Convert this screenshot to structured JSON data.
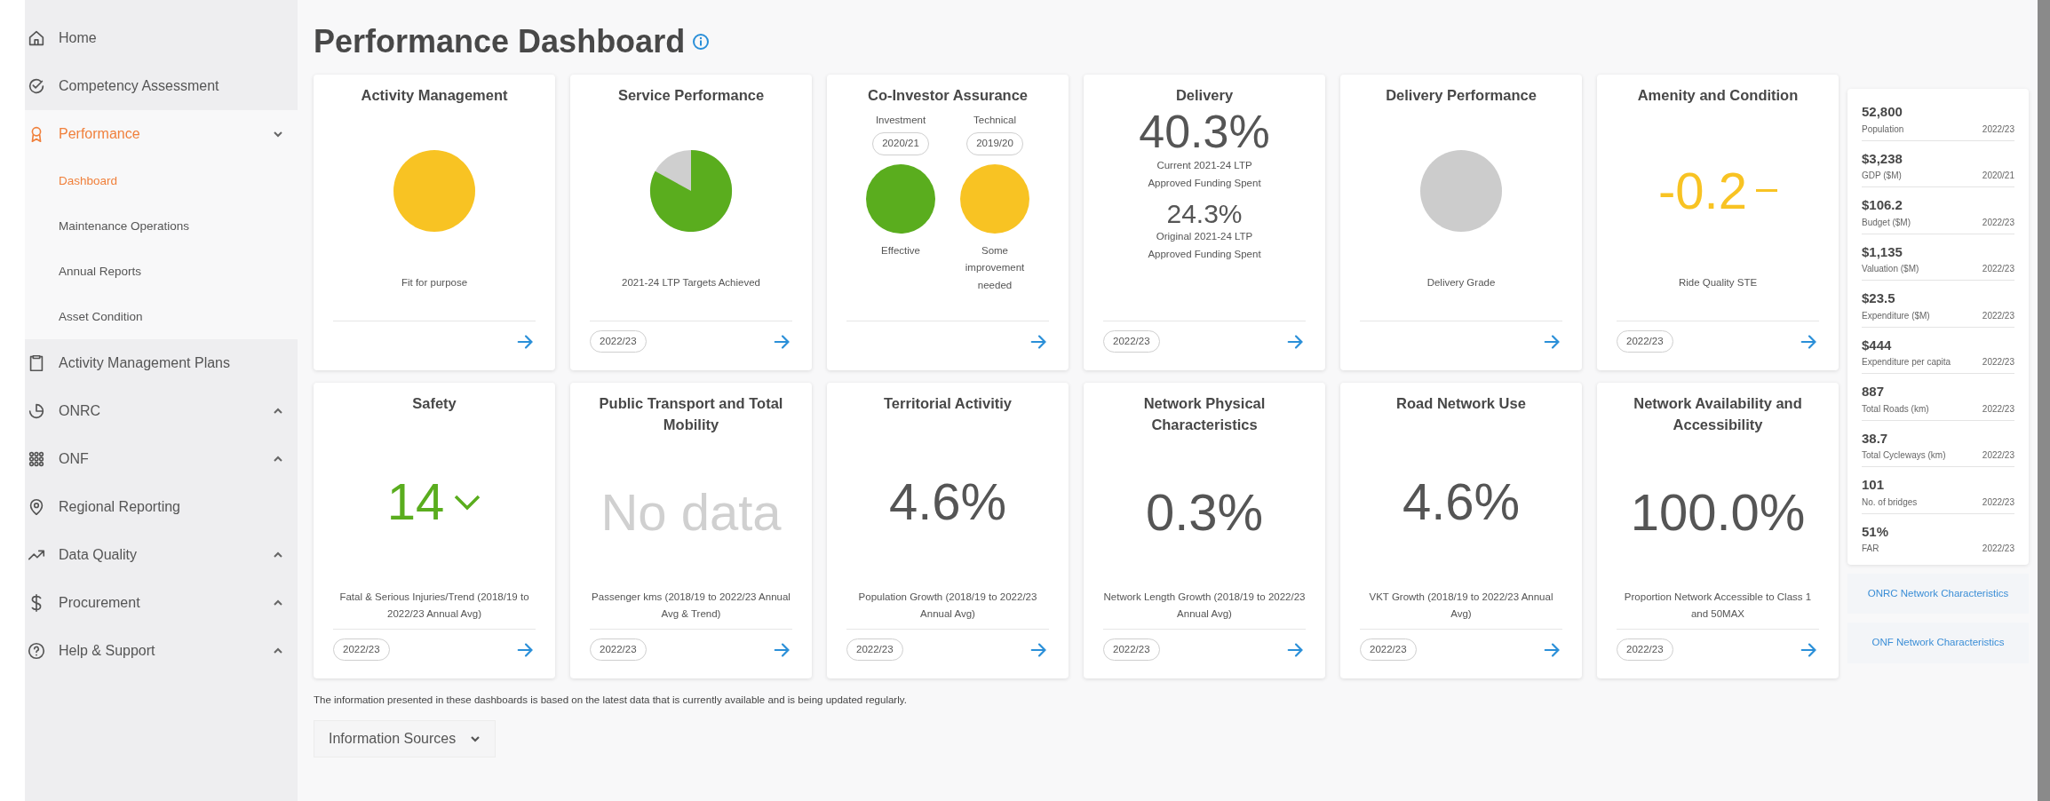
{
  "sidebar": {
    "items": [
      {
        "label": "Home",
        "selected": false
      },
      {
        "label": "Competency Assessment",
        "selected": false
      },
      {
        "label": "Performance",
        "selected": true,
        "expanded": true,
        "children": [
          {
            "label": "Dashboard",
            "selected": true
          },
          {
            "label": "Maintenance Operations",
            "selected": false
          },
          {
            "label": "Annual Reports",
            "selected": false
          },
          {
            "label": "Asset Condition",
            "selected": false
          }
        ]
      },
      {
        "label": "Activity Management Plans",
        "selected": false
      },
      {
        "label": "ONRC",
        "selected": false,
        "expanded": false
      },
      {
        "label": "ONF",
        "selected": false,
        "expanded": false
      },
      {
        "label": "Regional Reporting",
        "selected": false
      },
      {
        "label": "Data Quality",
        "selected": false,
        "expanded": false
      },
      {
        "label": "Procurement",
        "selected": false,
        "expanded": false
      },
      {
        "label": "Help & Support",
        "selected": false,
        "expanded": false
      }
    ]
  },
  "page": {
    "title": "Performance Dashboard"
  },
  "cards": [
    {
      "title": "Activity Management",
      "kind": "dot",
      "color": "#f8c323",
      "caption": "Fit for purpose"
    },
    {
      "title": "Service Performance",
      "kind": "pie",
      "caption": "2021-24 LTP Targets Achieved",
      "badge": "2022/23"
    },
    {
      "title": "Co-Investor Assurance",
      "kind": "dual",
      "items": [
        {
          "label": "Investment",
          "badge": "2020/21",
          "color": "#5aad1e",
          "caption": "Effective"
        },
        {
          "label": "Technical",
          "badge": "2019/20",
          "color": "#f8c323",
          "caption": "Some improvement needed"
        }
      ]
    },
    {
      "title": "Delivery",
      "kind": "figures",
      "figures": [
        {
          "value": "40.3%",
          "caption": "Current 2021-24 LTP Approved Funding Spent",
          "major": true
        },
        {
          "value": "24.3%",
          "caption": "Original 2021-24 LTP Approved Funding Spent",
          "major": false
        }
      ],
      "badge": "2022/23"
    },
    {
      "title": "Delivery Performance",
      "kind": "dot",
      "color": "#cccccc",
      "caption": "Delivery Grade"
    },
    {
      "title": "Amenity and Condition",
      "kind": "value",
      "value": "-0.2",
      "color": "#f8c323",
      "trend_down": false,
      "trend_flat": true,
      "caption": "Ride Quality STE",
      "badge": "2022/23"
    },
    {
      "title": "Safety",
      "kind": "value",
      "value": "14",
      "color": "#5aad1e",
      "trend_down": true,
      "trend_flat": false,
      "caption": "Fatal & Serious Injuries/Trend (2018/19 to 2022/23 Annual Avg)",
      "badge": "2022/23"
    },
    {
      "title": "Public Transport and Total Mobility",
      "kind": "value",
      "value": "No data",
      "color": "#d0d0d0",
      "trend_down": false,
      "trend_flat": false,
      "caption": "Passenger kms (2018/19 to 2022/23 Annual Avg & Trend)",
      "badge": "2022/23"
    },
    {
      "title": "Territorial Activitiy",
      "kind": "value",
      "value": "4.6%",
      "color": "#555555",
      "trend_down": false,
      "trend_flat": false,
      "caption": "Population Growth (2018/19 to 2022/23 Annual Avg)",
      "badge": "2022/23"
    },
    {
      "title": "Network Physical Characteristics",
      "kind": "value",
      "value": "0.3%",
      "color": "#555555",
      "trend_down": false,
      "trend_flat": false,
      "caption": "Network Length Growth (2018/19 to 2022/23 Annual Avg)",
      "badge": "2022/23"
    },
    {
      "title": "Road Network Use",
      "kind": "value",
      "value": "4.6%",
      "color": "#555555",
      "trend_down": false,
      "trend_flat": false,
      "caption": "VKT Growth (2018/19 to 2022/23 Annual Avg)",
      "badge": "2022/23"
    },
    {
      "title": "Network Availability and Accessibility",
      "kind": "value",
      "value": "100.0%",
      "color": "#555555",
      "trend_down": false,
      "trend_flat": false,
      "caption": "Proportion Network Accessible to Class 1 and 50MAX",
      "badge": "2022/23"
    }
  ],
  "note": "The information presented in these dashboards is based on the latest data that is currently available and is being updated regularly.",
  "sources_button": "Information Sources",
  "stats": [
    {
      "value": "52,800",
      "label": "Population",
      "year": "2022/23"
    },
    {
      "value": "$3,238",
      "label": "GDP ($M)",
      "year": "2020/21"
    },
    {
      "value": "$106.2",
      "label": "Budget ($M)",
      "year": "2022/23"
    },
    {
      "value": "$1,135",
      "label": "Valuation ($M)",
      "year": "2022/23"
    },
    {
      "value": "$23.5",
      "label": "Expenditure ($M)",
      "year": "2022/23"
    },
    {
      "value": "$444",
      "label": "Expenditure per capita",
      "year": "2022/23"
    },
    {
      "value": "887",
      "label": "Total Roads (km)",
      "year": "2022/23"
    },
    {
      "value": "38.7",
      "label": "Total Cycleways (km)",
      "year": "2022/23"
    },
    {
      "value": "101",
      "label": "No. of bridges",
      "year": "2022/23"
    },
    {
      "value": "51%",
      "label": "FAR",
      "year": "2022/23"
    }
  ],
  "links": [
    "ONRC Network Characteristics",
    "ONF Network Characteristics"
  ]
}
